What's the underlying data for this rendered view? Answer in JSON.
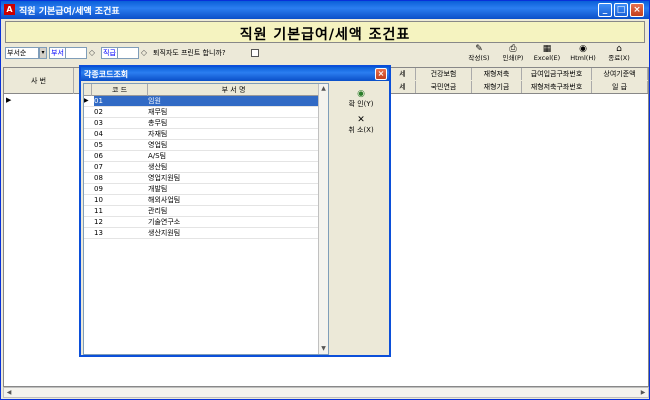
{
  "window": {
    "app_icon": "A",
    "title": "직원 기본급여/세액 조건표",
    "minimize": "_",
    "maximize": "□",
    "close": "×"
  },
  "header": {
    "title": "직원 기본급여/세액 조건표"
  },
  "filters": {
    "sort_combo": "부서순",
    "dept_label": "부서",
    "grade_label": "직급",
    "retiree_question": "퇴직자도 프린트 합니까?"
  },
  "toolbar": [
    {
      "icon": "write-icon",
      "glyph": "✎",
      "label": "작성(S)"
    },
    {
      "icon": "print-icon",
      "glyph": "⎙",
      "label": "인쇄(P)"
    },
    {
      "icon": "excel-icon",
      "glyph": "▦",
      "label": "Excel(E)"
    },
    {
      "icon": "html-icon",
      "glyph": "◉",
      "label": "Html(H)"
    },
    {
      "icon": "exit-icon",
      "glyph": "⌂",
      "label": "종료(X)"
    }
  ],
  "grid": {
    "left_header": "사 번",
    "headers_top": [
      "세",
      "건강보험",
      "재형저축",
      "급여입금구좌번호",
      "상여기준액"
    ],
    "headers_bottom": [
      "세",
      "국민연금",
      "재형기금",
      "재형저축구좌번호",
      "일 급"
    ]
  },
  "dialog": {
    "title": "각종코드조회",
    "col_code": "코 드",
    "col_name": "부 서 명",
    "rows": [
      {
        "code": "01",
        "name": "임원"
      },
      {
        "code": "02",
        "name": "재무팀"
      },
      {
        "code": "03",
        "name": "총무팀"
      },
      {
        "code": "04",
        "name": "자재팀"
      },
      {
        "code": "05",
        "name": "영업팀"
      },
      {
        "code": "06",
        "name": "A/S팀"
      },
      {
        "code": "07",
        "name": "생산팀"
      },
      {
        "code": "08",
        "name": "영업지원팀"
      },
      {
        "code": "09",
        "name": "개발팀"
      },
      {
        "code": "10",
        "name": "해외사업팀"
      },
      {
        "code": "11",
        "name": "관리팀"
      },
      {
        "code": "12",
        "name": "기술연구소"
      },
      {
        "code": "13",
        "name": "생산지원팀"
      }
    ],
    "ok_label": "확 인(Y)",
    "cancel_label": "취 소(X)"
  }
}
